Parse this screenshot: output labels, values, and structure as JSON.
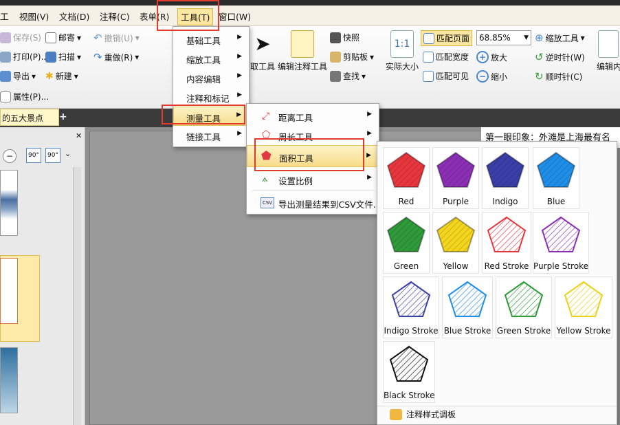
{
  "menubar": {
    "items": [
      "工具(T)",
      "视图(V)",
      "文档(D)",
      "注释(C)",
      "表单(R)",
      "工具(T)",
      "窗口(W)"
    ]
  },
  "ribbon": {
    "save": "保存(S)",
    "mail": "邮寄",
    "undo": "撤销(U)",
    "print": "打印(P)...",
    "scan": "扫描",
    "redo": "重做(R)",
    "export": "导出",
    "new": "新建",
    "properties": "属性(P)...",
    "select_tool": "取工具",
    "edit_annot": "编辑注释工具",
    "snapshot": "快照",
    "clipboard": "剪贴板",
    "find": "查找",
    "actual_size": "实际大小",
    "fit_page": "匹配页面",
    "fit_width": "匹配宽度",
    "fit_visible": "匹配可见",
    "zoom_value": "68.85%",
    "zoom_tool": "缩放工具",
    "zoom_in": "放大",
    "zoom_out": "缩小",
    "rotate_ccw": "逆时针(W)",
    "rotate_cw": "顺时针(C)",
    "edit_text": "编辑内"
  },
  "tabs": {
    "doc_tab": "的五大景点",
    "new_tab": "+"
  },
  "page": {
    "visible_text": "第一眼印象：外滩是上海最有名"
  },
  "tools_menu": {
    "items": [
      "基础工具",
      "缩放工具",
      "内容编辑",
      "注释和标记",
      "测量工具",
      "链接工具"
    ]
  },
  "measure_menu": {
    "items": [
      "距离工具",
      "周长工具",
      "面积工具",
      "设置比例",
      "导出测量结果到CSV文件..."
    ]
  },
  "area_gallery": {
    "swatches": [
      {
        "name": "Red",
        "color": "#e8363f",
        "style": "fill"
      },
      {
        "name": "Purple",
        "color": "#8b2fb5",
        "style": "fill"
      },
      {
        "name": "Indigo",
        "color": "#3a3fa8",
        "style": "fill"
      },
      {
        "name": "Blue",
        "color": "#1f8ee8",
        "style": "fill"
      },
      {
        "name": "Green",
        "color": "#2f9a3a",
        "style": "fill"
      },
      {
        "name": "Yellow",
        "color": "#f4d51d",
        "style": "fill"
      },
      {
        "name": "Red Stroke",
        "color": "#e8363f",
        "style": "stroke"
      },
      {
        "name": "Purple Stroke",
        "color": "#8b2fb5",
        "style": "stroke"
      },
      {
        "name": "Indigo Stroke",
        "color": "#3a3fa8",
        "style": "stroke"
      },
      {
        "name": "Blue Stroke",
        "color": "#1f8ee8",
        "style": "stroke"
      },
      {
        "name": "Green Stroke",
        "color": "#2f9a3a",
        "style": "stroke"
      },
      {
        "name": "Yellow Stroke",
        "color": "#e9d21a",
        "style": "stroke"
      },
      {
        "name": "Black Stroke",
        "color": "#111111",
        "style": "stroke"
      }
    ],
    "footer": "注释样式调板"
  }
}
